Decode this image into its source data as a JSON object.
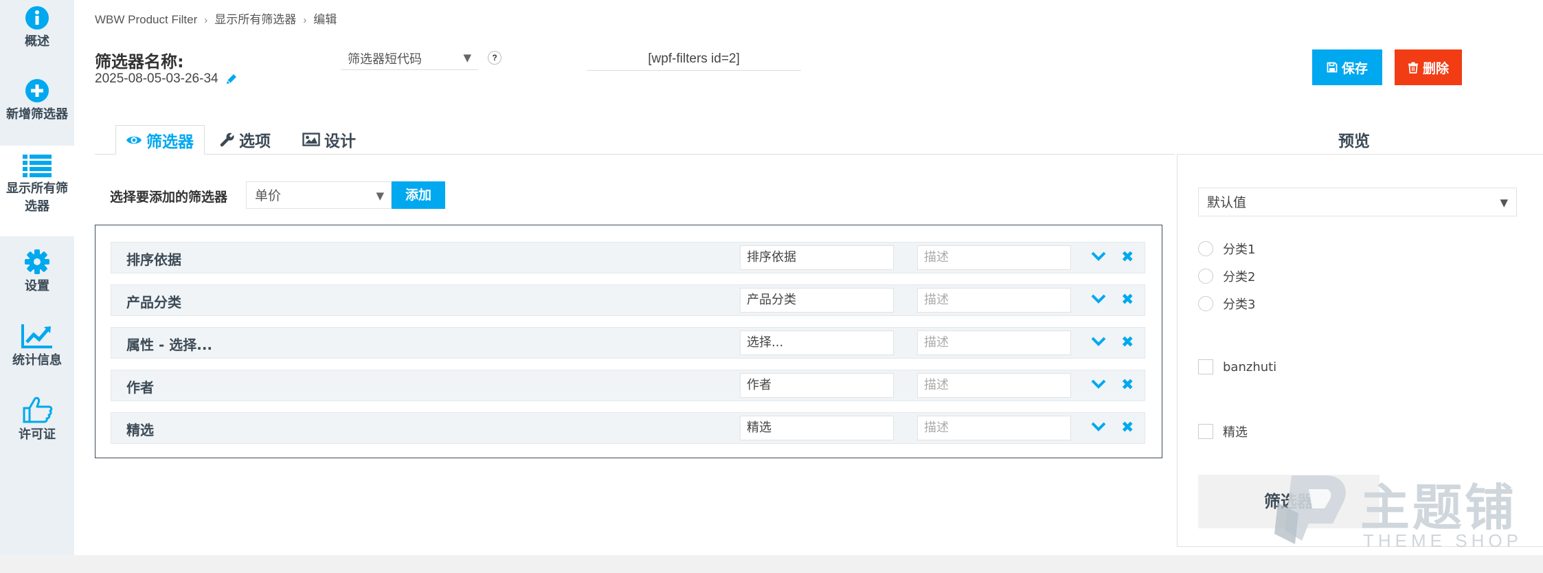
{
  "sidebar": {
    "items": [
      {
        "label": "概述",
        "icon": "info-icon"
      },
      {
        "label": "新增筛选器",
        "icon": "plus-circle-icon"
      },
      {
        "label": "显示所有筛选器",
        "icon": "list-icon"
      },
      {
        "label": "设置",
        "icon": "gear-icon"
      },
      {
        "label": "统计信息",
        "icon": "chart-line-icon"
      },
      {
        "label": "许可证",
        "icon": "thumbs-up-icon"
      }
    ],
    "active_index": 2
  },
  "breadcrumb": {
    "items": [
      "WBW Product Filter",
      "显示所有筛选器",
      "编辑"
    ]
  },
  "header": {
    "name_label": "筛选器名称:",
    "name_value": "2025-08-05-03-26-34",
    "shortcode_select": "筛选器短代码",
    "help": "?",
    "shortcode_value": "[wpf-filters id=2]",
    "save_label": "保存",
    "delete_label": "删除"
  },
  "tabs": [
    {
      "label": "筛选器",
      "icon": "eye-icon",
      "active": true
    },
    {
      "label": "选项",
      "icon": "wrench-icon",
      "active": false
    },
    {
      "label": "设计",
      "icon": "image-icon",
      "active": false
    }
  ],
  "add_filter": {
    "label": "选择要添加的筛选器",
    "selected": "单价",
    "button": "添加"
  },
  "filters": [
    {
      "title": "排序依据",
      "value": "排序依据",
      "desc_placeholder": "描述"
    },
    {
      "title": "产品分类",
      "value": "产品分类",
      "desc_placeholder": "描述"
    },
    {
      "title": "属性 - 选择...",
      "value": "选择...",
      "desc_placeholder": "描述"
    },
    {
      "title": "作者",
      "value": "作者",
      "desc_placeholder": "描述"
    },
    {
      "title": "精选",
      "value": "精选",
      "desc_placeholder": "描述"
    }
  ],
  "preview": {
    "title": "预览",
    "select_value": "默认值",
    "radios": [
      "分类1",
      "分类2",
      "分类3"
    ],
    "checkbox_author": "banzhuti",
    "checkbox_featured": "精选",
    "button": "筛选器"
  },
  "watermark": {
    "cn": "主题铺",
    "en": "THEME SHOP"
  },
  "colors": {
    "accent": "#00a8ef",
    "danger": "#f23d14",
    "sidebar_bg": "#eaf0f4",
    "text_dark": "#3c4a56"
  }
}
